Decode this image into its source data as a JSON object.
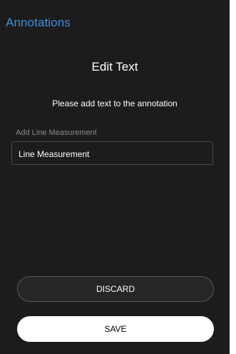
{
  "header": {
    "title": "Annotations"
  },
  "dialog": {
    "title": "Edit Text",
    "message": "Please add text to the annotation",
    "field": {
      "label": "Add Line Measurement",
      "value": "Line Measurement"
    },
    "buttons": {
      "discard_label": "DISCARD",
      "save_label": "SAVE"
    }
  },
  "colors": {
    "background": "#1c1c1c",
    "accent": "#3d8fe0",
    "text": "#ffffff",
    "muted_label": "#8a8a8a"
  }
}
